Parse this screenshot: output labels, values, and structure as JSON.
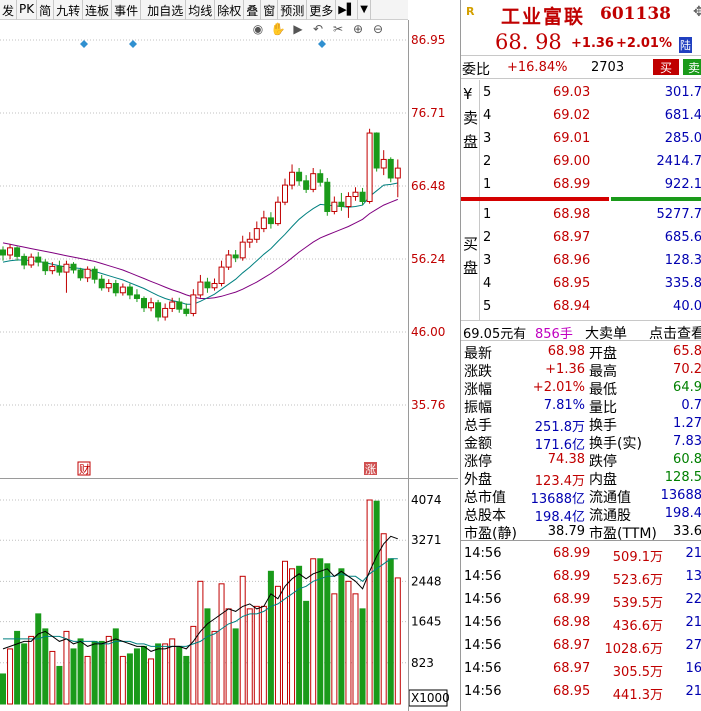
{
  "toolbar": {
    "items": [
      "发",
      "PK",
      "简",
      "九转",
      "连板",
      "事件",
      "加自选",
      "均线",
      "除权",
      "叠",
      "窗",
      "预测",
      "更多"
    ],
    "end_icon": "▶▌",
    "dropdown_icon": "▼"
  },
  "chart_tools": {
    "icons": [
      "eye-icon",
      "hand-icon",
      "play-icon",
      "undo-icon",
      "scissors-icon",
      "zoom-in-icon",
      "zoom-out-icon"
    ]
  },
  "colors": {
    "up": "#c00000",
    "down": "#1a9a1a",
    "ma_fast": "#008080",
    "ma_slow": "#800080",
    "vol_ma": "#000000",
    "grid": "#c0c0c0"
  },
  "kline": {
    "price_axis": [
      "86.95",
      "76.71",
      "66.48",
      "56.24",
      "46.00",
      "35.76"
    ],
    "event_markers": [
      "财",
      "涨"
    ]
  },
  "volume": {
    "axis": [
      "4074",
      "3271",
      "2448",
      "1645",
      "823"
    ],
    "unit": "X1000"
  },
  "chart_data": [
    {
      "type": "candlestick",
      "title": "",
      "y_ticks": [
        86.95,
        76.71,
        66.48,
        56.24,
        46.0,
        35.76
      ],
      "ylim": [
        35.76,
        86.95
      ],
      "candles": [
        [
          57.5,
          56.8,
          58.0,
          56.0
        ],
        [
          56.8,
          57.8,
          58.3,
          56.2
        ],
        [
          57.8,
          56.6,
          58.0,
          56.0
        ],
        [
          56.6,
          55.4,
          57.0,
          54.8
        ],
        [
          55.4,
          56.5,
          57.0,
          55.0
        ],
        [
          56.5,
          55.8,
          57.2,
          55.2
        ],
        [
          55.8,
          54.6,
          56.2,
          54.0
        ],
        [
          54.6,
          55.2,
          55.8,
          54.1
        ],
        [
          55.2,
          54.4,
          56.0,
          53.9
        ],
        [
          54.4,
          55.5,
          56.0,
          51.5
        ],
        [
          55.5,
          54.7,
          55.8,
          54.2
        ],
        [
          54.7,
          53.6,
          55.0,
          53.2
        ],
        [
          53.6,
          54.8,
          55.2,
          53.0
        ],
        [
          54.8,
          53.4,
          55.2,
          52.8
        ],
        [
          53.4,
          52.2,
          54.0,
          51.8
        ],
        [
          52.2,
          52.8,
          53.4,
          51.6
        ],
        [
          52.8,
          51.5,
          53.3,
          51.0
        ],
        [
          51.5,
          52.3,
          52.8,
          51.1
        ],
        [
          52.3,
          51.2,
          52.8,
          50.6
        ],
        [
          51.2,
          50.7,
          52.0,
          50.2
        ],
        [
          50.7,
          49.4,
          51.0,
          48.8
        ],
        [
          49.4,
          50.1,
          50.8,
          48.9
        ],
        [
          50.1,
          48.1,
          50.5,
          47.5
        ],
        [
          48.1,
          49.3,
          50.0,
          47.6
        ],
        [
          49.3,
          50.2,
          50.8,
          48.8
        ],
        [
          50.2,
          49.2,
          50.8,
          48.7
        ],
        [
          49.2,
          48.6,
          50.0,
          48.2
        ],
        [
          48.6,
          51.2,
          52.0,
          48.2
        ],
        [
          51.2,
          53.0,
          54.0,
          50.8
        ],
        [
          53.0,
          52.2,
          53.6,
          51.5
        ],
        [
          52.2,
          52.8,
          53.5,
          51.8
        ],
        [
          52.8,
          55.1,
          56.0,
          52.4
        ],
        [
          55.1,
          56.8,
          57.5,
          54.7
        ],
        [
          56.8,
          56.4,
          57.5,
          55.8
        ],
        [
          56.4,
          58.6,
          59.5,
          56.0
        ],
        [
          58.6,
          59.0,
          60.0,
          57.8
        ],
        [
          59.0,
          60.5,
          61.5,
          58.5
        ],
        [
          60.5,
          62.0,
          63.0,
          60.0
        ],
        [
          62.0,
          61.2,
          62.8,
          60.5
        ],
        [
          61.2,
          64.2,
          65.0,
          60.9
        ],
        [
          64.2,
          66.6,
          67.5,
          63.8
        ],
        [
          66.6,
          68.4,
          69.5,
          66.0
        ],
        [
          68.4,
          67.2,
          69.0,
          66.5
        ],
        [
          67.2,
          66.0,
          68.0,
          65.5
        ],
        [
          66.0,
          68.2,
          69.0,
          65.6
        ],
        [
          68.2,
          67.0,
          68.8,
          66.4
        ],
        [
          67.0,
          62.9,
          67.6,
          62.3
        ],
        [
          62.9,
          64.2,
          65.0,
          62.5
        ],
        [
          64.2,
          63.6,
          65.5,
          63.0
        ],
        [
          63.6,
          65.0,
          65.6,
          62.0
        ],
        [
          65.0,
          65.6,
          66.3,
          64.4
        ],
        [
          65.6,
          64.3,
          66.2,
          63.8
        ],
        [
          64.3,
          73.9,
          74.5,
          64.0
        ],
        [
          73.9,
          69.0,
          74.0,
          68.5
        ],
        [
          69.0,
          70.2,
          71.5,
          68.0
        ],
        [
          70.2,
          67.6,
          70.5,
          67.0
        ],
        [
          67.6,
          68.98,
          70.2,
          64.9
        ]
      ],
      "ma_fast": [
        55.8,
        56.0,
        56.1,
        56.1,
        56.0,
        55.9,
        55.7,
        55.5,
        55.3,
        55.1,
        55.0,
        54.9,
        54.7,
        54.5,
        54.2,
        53.9,
        53.6,
        53.3,
        52.9,
        52.5,
        52.1,
        51.6,
        51.1,
        50.7,
        50.4,
        50.2,
        49.9,
        49.9,
        50.3,
        50.8,
        51.3,
        52.0,
        52.7,
        53.4,
        54.3,
        55.1,
        56.0,
        56.9,
        57.7,
        58.7,
        59.7,
        60.8,
        61.8,
        62.6,
        63.3,
        63.9,
        63.8,
        63.7,
        63.6,
        63.5,
        63.6,
        63.8,
        65.0,
        65.8,
        66.6,
        66.7,
        66.9
      ],
      "ma_slow": [
        58.5,
        58.3,
        58.1,
        57.9,
        57.7,
        57.5,
        57.3,
        57.1,
        56.9,
        56.7,
        56.5,
        56.3,
        56.1,
        55.9,
        55.6,
        55.3,
        55.0,
        54.7,
        54.3,
        53.9,
        53.5,
        53.1,
        52.7,
        52.3,
        51.9,
        51.6,
        51.2,
        50.9,
        50.7,
        50.7,
        50.8,
        51.0,
        51.3,
        51.6,
        52.0,
        52.5,
        53.0,
        53.6,
        54.2,
        54.9,
        55.6,
        56.4,
        57.2,
        57.9,
        58.6,
        59.2,
        59.6,
        60.0,
        60.4,
        60.8,
        61.3,
        61.8,
        62.6,
        63.2,
        63.8,
        64.2,
        64.6
      ]
    },
    {
      "type": "bar",
      "title": "",
      "y_ticks": [
        4074,
        3271,
        2448,
        1645,
        823
      ],
      "ylim": [
        0,
        4074
      ],
      "values": [
        600,
        1100,
        1450,
        1200,
        1350,
        1800,
        1500,
        1050,
        750,
        1450,
        1100,
        1300,
        950,
        1250,
        1250,
        1350,
        1500,
        950,
        1000,
        1100,
        1150,
        900,
        1200,
        1200,
        1300,
        1150,
        950,
        1550,
        2450,
        1900,
        1450,
        2400,
        1900,
        1500,
        2550,
        1900,
        1950,
        1950,
        2650,
        2350,
        2850,
        2700,
        2750,
        2050,
        2900,
        2900,
        2800,
        2200,
        2700,
        2450,
        2200,
        1900,
        4074,
        4050,
        3400,
        2900,
        2518
      ],
      "up": [
        false,
        true,
        false,
        false,
        true,
        false,
        false,
        true,
        false,
        true,
        false,
        false,
        true,
        false,
        false,
        true,
        false,
        true,
        false,
        false,
        false,
        true,
        false,
        true,
        true,
        false,
        false,
        true,
        true,
        false,
        true,
        true,
        true,
        false,
        true,
        true,
        true,
        true,
        false,
        true,
        true,
        true,
        false,
        false,
        true,
        false,
        false,
        true,
        false,
        true,
        true,
        false,
        true,
        false,
        true,
        false,
        true
      ],
      "ma5": [
        1100,
        1150,
        1200,
        1250,
        1250,
        1400,
        1450,
        1350,
        1250,
        1300,
        1200,
        1250,
        1150,
        1200,
        1200,
        1250,
        1300,
        1250,
        1200,
        1150,
        1150,
        1050,
        1100,
        1100,
        1150,
        1150,
        1100,
        1250,
        1450,
        1600,
        1700,
        1800,
        1900,
        1850,
        1950,
        2000,
        1900,
        1950,
        2200,
        2100,
        2350,
        2500,
        2600,
        2500,
        2600,
        2650,
        2700,
        2550,
        2650,
        2550,
        2450,
        2300,
        2650,
        2950,
        3200,
        3350,
        3300
      ],
      "ma10": [
        1300,
        1300,
        1300,
        1300,
        1300,
        1300,
        1350,
        1350,
        1350,
        1300,
        1250,
        1250,
        1250,
        1250,
        1200,
        1200,
        1250,
        1250,
        1250,
        1200,
        1200,
        1150,
        1150,
        1150,
        1150,
        1150,
        1150,
        1200,
        1250,
        1350,
        1400,
        1500,
        1600,
        1650,
        1750,
        1800,
        1800,
        1850,
        1950,
        2000,
        2100,
        2200,
        2300,
        2350,
        2450,
        2500,
        2550,
        2550,
        2600,
        2550,
        2550,
        2450,
        2600,
        2700,
        2800,
        2900,
        2900
      ]
    }
  ],
  "quote": {
    "r_icon": "R",
    "name": "工业富联",
    "code": "601138",
    "pin_icon": "✥",
    "price": "68. 98",
    "change": "+1.36",
    "change_pct": "+2.01%",
    "badge": "陆",
    "weibi_label": "委比",
    "weibi_pct": "+16.84%",
    "weibi_diff": "2703",
    "buy_label": "买",
    "sell_label": "卖",
    "sell_side_label": "¥\n卖\n盘",
    "buy_side_label": "买\n盘",
    "asks": [
      {
        "lvl": "5",
        "price": "69.03",
        "vol": "301.7"
      },
      {
        "lvl": "4",
        "price": "69.02",
        "vol": "681.4"
      },
      {
        "lvl": "3",
        "price": "69.01",
        "vol": "285.0"
      },
      {
        "lvl": "2",
        "price": "69.00",
        "vol": "2414.7"
      },
      {
        "lvl": "1",
        "price": "68.99",
        "vol": "922.1"
      }
    ],
    "bids": [
      {
        "lvl": "1",
        "price": "68.98",
        "vol": "5277.7"
      },
      {
        "lvl": "2",
        "price": "68.97",
        "vol": "685.6"
      },
      {
        "lvl": "3",
        "price": "68.96",
        "vol": "128.3"
      },
      {
        "lvl": "4",
        "price": "68.95",
        "vol": "335.8"
      },
      {
        "lvl": "5",
        "price": "68.94",
        "vol": "40.0"
      }
    ],
    "summary": {
      "price": "69.05元有",
      "vol": "856手",
      "big": "大卖单",
      "link": "点击查看"
    },
    "stats": [
      {
        "k1": "最新",
        "v1": "68.98",
        "c1": "red",
        "k2": "开盘",
        "v2": "65.8",
        "c2": "red"
      },
      {
        "k1": "涨跌",
        "v1": "+1.36",
        "c1": "red",
        "k2": "最高",
        "v2": "70.2",
        "c2": "red"
      },
      {
        "k1": "涨幅",
        "v1": "+2.01%",
        "c1": "red",
        "k2": "最低",
        "v2": "64.9",
        "c2": "green"
      },
      {
        "k1": "振幅",
        "v1": "7.81%",
        "c1": "blue",
        "k2": "量比",
        "v2": "0.7",
        "c2": "blue"
      },
      {
        "k1": "总手",
        "v1": "251.8万",
        "c1": "blue",
        "k2": "换手",
        "v2": "1.27",
        "c2": "blue"
      },
      {
        "k1": "金额",
        "v1": "171.6亿",
        "c1": "blue",
        "k2": "换手(实)",
        "v2": "7.83",
        "c2": "blue"
      },
      {
        "k1": "涨停",
        "v1": "74.38",
        "c1": "red",
        "k2": "跌停",
        "v2": "60.8",
        "c2": "green"
      },
      {
        "k1": "外盘",
        "v1": "123.4万",
        "c1": "red",
        "k2": "内盘",
        "v2": "128.5",
        "c2": "green"
      },
      {
        "k1": "总市值",
        "v1": "13688亿",
        "c1": "blue",
        "k2": "流通值",
        "v2": "13688",
        "c2": "blue"
      },
      {
        "k1": "总股本",
        "v1": "198.4亿",
        "c1": "blue",
        "k2": "流通股",
        "v2": "198.4",
        "c2": "blue"
      },
      {
        "k1": "市盈(静)",
        "v1": "38.79",
        "c1": "black",
        "k2": "市盈(TTM)",
        "v2": "33.6",
        "c2": "black"
      }
    ],
    "ticks": [
      {
        "time": "14:56",
        "price": "68.99",
        "amt": "509.1万",
        "cnt": "21"
      },
      {
        "time": "14:56",
        "price": "68.99",
        "amt": "523.6万",
        "cnt": "13"
      },
      {
        "time": "14:56",
        "price": "68.99",
        "amt": "539.5万",
        "cnt": "22"
      },
      {
        "time": "14:56",
        "price": "68.98",
        "amt": "436.6万",
        "cnt": "21"
      },
      {
        "time": "14:56",
        "price": "68.97",
        "amt": "1028.6万",
        "cnt": "27"
      },
      {
        "time": "14:56",
        "price": "68.97",
        "amt": "305.5万",
        "cnt": "16"
      },
      {
        "time": "14:56",
        "price": "68.95",
        "amt": "441.3万",
        "cnt": "21"
      }
    ]
  }
}
